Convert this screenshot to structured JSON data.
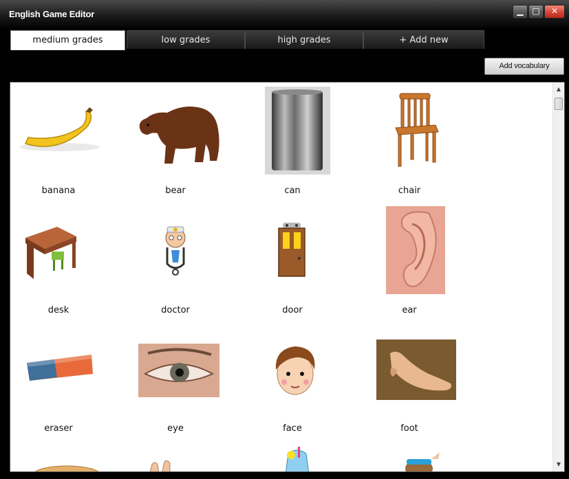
{
  "window": {
    "title": "English Game Editor",
    "minimize": "▁",
    "maximize": "□",
    "close": "✕"
  },
  "tabs": [
    {
      "label": "medium grades",
      "active": true
    },
    {
      "label": "low grades",
      "active": false
    },
    {
      "label": "high grades",
      "active": false
    },
    {
      "label": "+ Add new",
      "active": false
    }
  ],
  "toolbar": {
    "add_vocabulary": "Add vocabulary"
  },
  "vocabulary": [
    {
      "word": "banana",
      "icon": "banana-icon"
    },
    {
      "word": "bear",
      "icon": "bear-icon"
    },
    {
      "word": "can",
      "icon": "can-icon"
    },
    {
      "word": "chair",
      "icon": "chair-icon"
    },
    {
      "word": "desk",
      "icon": "desk-icon"
    },
    {
      "word": "doctor",
      "icon": "doctor-icon"
    },
    {
      "word": "door",
      "icon": "door-icon"
    },
    {
      "word": "ear",
      "icon": "ear-icon"
    },
    {
      "word": "eraser",
      "icon": "eraser-icon"
    },
    {
      "word": "eye",
      "icon": "eye-icon"
    },
    {
      "word": "face",
      "icon": "face-icon"
    },
    {
      "word": "foot",
      "icon": "foot-icon"
    }
  ],
  "partial_row_icons": [
    "bread-icon",
    "hand-icon",
    "juice-icon",
    "girl-icon"
  ],
  "scrollbar": {
    "up": "▲",
    "down": "▼"
  }
}
